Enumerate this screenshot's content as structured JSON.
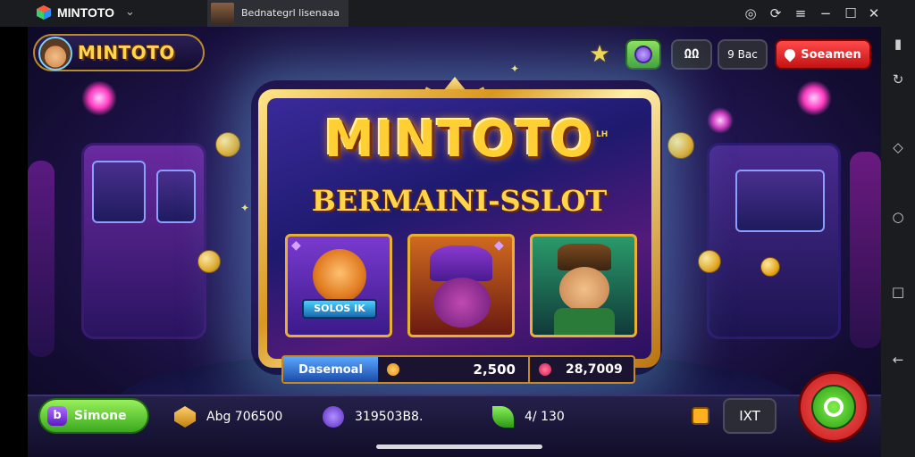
{
  "titlebar": {
    "app_name": "MINTOTO",
    "tab_title": "Bednategrl lisenaaa",
    "controls": [
      "compass-icon",
      "refresh-icon",
      "menu-icon",
      "minimize-icon",
      "maximize-icon",
      "close-icon"
    ]
  },
  "sidebar": {
    "icons": [
      "settings-icon",
      "rotate-icon",
      "screenshot-icon",
      "home-icon",
      "recent-icon",
      "back-icon"
    ]
  },
  "game": {
    "logo_text": "MINTOTO",
    "top_buttons": {
      "box_label": "ΩΩ",
      "sec_label": "9 Bac",
      "red_label": "Soeamen"
    },
    "hero": {
      "title": "MINTOTO",
      "title_sup": "LH",
      "subtitle": "BERMAINI-SSLOT",
      "reel1_label": "SOLOS IK"
    },
    "stats": {
      "label": "Dasemoal",
      "value_mid": "2,500",
      "value_right": "28,7009"
    },
    "bottom": {
      "green_btn": "Simone",
      "green_btn_icon": "b",
      "item1": "Abg 706500",
      "item2": "319503B8.",
      "item3": "4/ 130",
      "kk_label": "IXT"
    }
  },
  "colors": {
    "accent_gold": "#ffd54a",
    "red_button": "#e02020",
    "green_button": "#5cc82e"
  }
}
